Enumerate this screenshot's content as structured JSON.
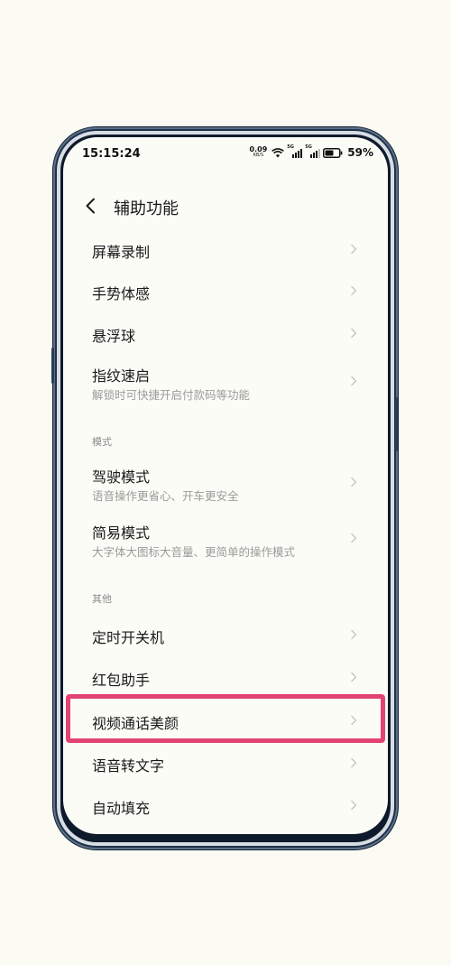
{
  "status_bar": {
    "time": "15:15:24",
    "net_speed_value": "0.09",
    "net_speed_unit": "KB/S",
    "sim1_tag": "5G",
    "sim2_tag": "5G",
    "battery": "59%"
  },
  "header": {
    "title": "辅助功能"
  },
  "items": [
    {
      "label": "屏幕录制"
    },
    {
      "label": "手势体感"
    },
    {
      "label": "悬浮球"
    },
    {
      "label": "指纹速启",
      "subtitle": "解锁时可快捷开启付款码等功能"
    }
  ],
  "section_mode": {
    "title": "模式",
    "items": [
      {
        "label": "驾驶模式",
        "subtitle": "语音操作更省心、开车更安全"
      },
      {
        "label": "简易模式",
        "subtitle": "大字体大图标大音量、更简单的操作模式"
      }
    ]
  },
  "section_other": {
    "title": "其他",
    "items": [
      {
        "label": "定时开关机"
      },
      {
        "label": "红包助手"
      },
      {
        "label": "视频通话美颜"
      },
      {
        "label": "语音转文字"
      },
      {
        "label": "自动填充"
      }
    ]
  },
  "colors": {
    "highlight": "#e24372",
    "background": "#fbfbf4",
    "phone_frame": "#1f3149"
  },
  "icons": {
    "back": "chevron-left-icon",
    "row_arrow": "chevron-right-icon",
    "wifi": "wifi-icon",
    "signal": "signal-icon",
    "battery": "battery-icon"
  }
}
